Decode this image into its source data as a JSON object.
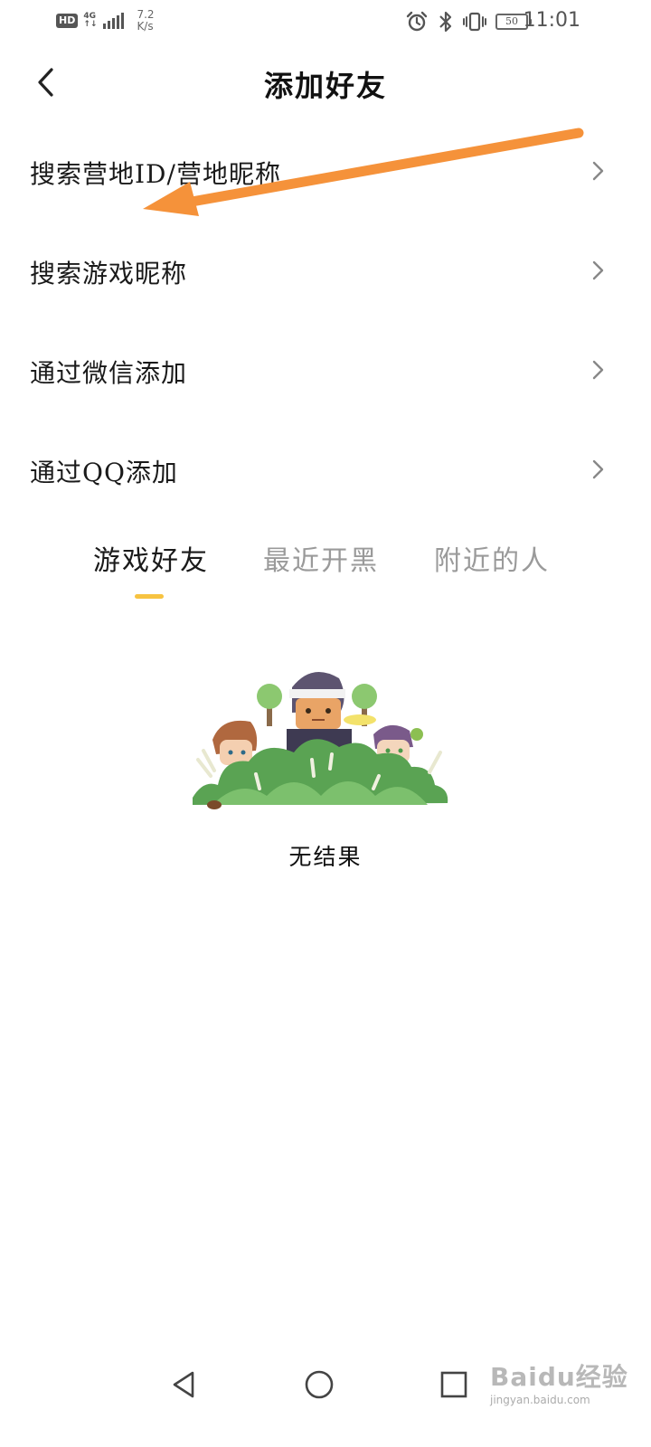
{
  "status_bar": {
    "hd_badge": "HD",
    "network_type": "4G",
    "net_arrows": "↑↓",
    "speed_value": "7.2",
    "speed_unit": "K/s",
    "battery_level": "50",
    "time": "11:01",
    "icons": [
      "alarm-icon",
      "bluetooth-icon",
      "vibrate-icon",
      "battery-icon"
    ]
  },
  "header": {
    "title": "添加好友",
    "back_icon": "chevron-left-icon"
  },
  "menu": {
    "items": [
      {
        "label": "搜索营地ID/营地昵称",
        "icon": "chevron-right-icon"
      },
      {
        "label": "搜索游戏昵称",
        "icon": "chevron-right-icon"
      },
      {
        "label": "通过微信添加",
        "icon": "chevron-right-icon"
      },
      {
        "label": "通过QQ添加",
        "icon": "chevron-right-icon"
      }
    ]
  },
  "tabs": {
    "items": [
      {
        "label": "游戏好友",
        "active": true
      },
      {
        "label": "最近开黑",
        "active": false
      },
      {
        "label": "附近的人",
        "active": false
      }
    ],
    "indicator_color": "#f7c341"
  },
  "empty_state": {
    "illustration": "heroes-behind-bush-illustration",
    "text": "无结果"
  },
  "nav_bar": {
    "icons": [
      "back-triangle-icon",
      "home-circle-icon",
      "recents-square-icon"
    ]
  },
  "watermark": {
    "text": "Baidu经验",
    "url": "jingyan.baidu.com"
  },
  "colors": {
    "annotation_arrow": "#f5923a",
    "active_text": "#1a1a1a",
    "inactive_text": "#9a9a9a",
    "accent": "#f7c341",
    "chevron": "#888888"
  }
}
